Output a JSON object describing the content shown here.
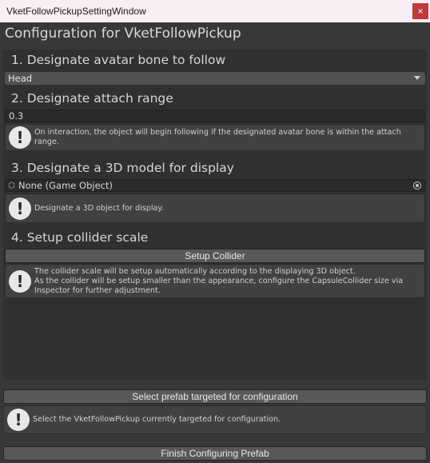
{
  "window": {
    "title": "VketFollowPickupSettingWindow",
    "close_glyph": "×"
  },
  "header": "Configuration for VketFollowPickup",
  "sections": [
    {
      "title": "1. Designate avatar bone to follow",
      "dropdown_value": "Head"
    },
    {
      "title": "2. Designate attach range",
      "field_value": "0.3",
      "help": [
        "On interaction, the object will begin following if the designated avatar bone is within the attach",
        "range."
      ]
    },
    {
      "title": "3. Designate a 3D model for display",
      "object_field": "None (Game Object)",
      "help": [
        "Designate a 3D object for display."
      ]
    },
    {
      "title": "4. Setup collider scale",
      "button": "Setup Collider",
      "help": [
        "The collider scale will be setup automatically according to the displaying 3D object.",
        "As the collider will be setup smaller than the appearance, configure the CapsuleCollider size via",
        "Inspector for further adjustment."
      ]
    }
  ],
  "select_button": "Select prefab targeted for configuration",
  "select_help": [
    "Select the VketFollowPickup currently targeted for configuration."
  ],
  "finish_button": "Finish Configuring Prefab",
  "help_icon_glyph": "!"
}
